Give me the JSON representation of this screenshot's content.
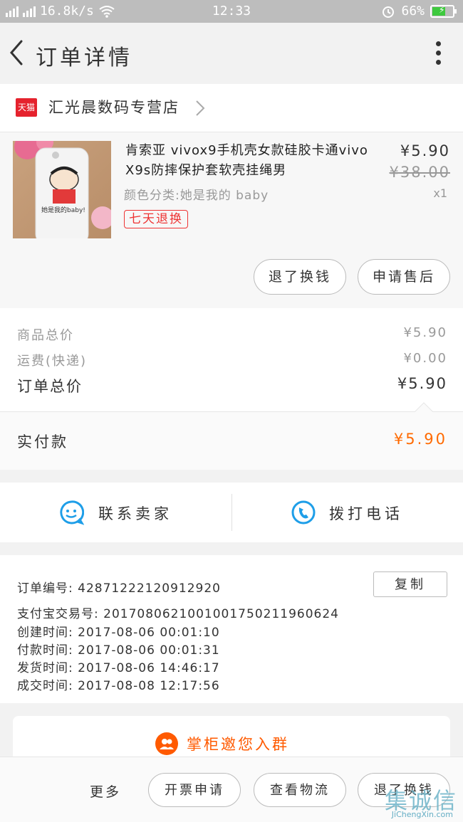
{
  "status_bar": {
    "network_speed": "16.8k/s",
    "time": "12:33",
    "battery": "66%",
    "battery_level": 0.66,
    "sim1": "4G",
    "sim2": "2G"
  },
  "nav": {
    "title": "订单详情"
  },
  "store": {
    "badge": "天猫",
    "name": "汇光晨数码专营店"
  },
  "product": {
    "title": "肯索亚 vivox9手机壳女款硅胶卡通vivo X9s防摔保护套软壳挂绳男",
    "sku": "颜色分类:她是我的 baby",
    "tag": "七天退换",
    "price": "¥5.90",
    "original_price": "¥38.00",
    "quantity": "x1",
    "refund_label": "退了换钱",
    "aftersale_label": "申请售后"
  },
  "summary": {
    "goods_total_label": "商品总价",
    "goods_total": "¥5.90",
    "shipping_label": "运费(快递)",
    "shipping": "¥0.00",
    "order_total_label": "订单总价",
    "order_total": "¥5.90",
    "paid_label": "实付款",
    "paid": "¥5.90"
  },
  "contact": {
    "seller_label": "联系卖家",
    "call_label": "拨打电话"
  },
  "order_info": {
    "order_no": "订单编号: 428712221​20912920",
    "copy_label": "复制",
    "alipay_no": "支付宝交易号: 2017080621001001750211960624",
    "created": "创建时间: 2017-08-06 00:01:10",
    "paid_time": "付款时间: 2017-08-06 00:01:31",
    "shipped": "发货时间: 2017-08-06 14:46:17",
    "completed": "成交时间: 2017-08-08 12:17:56"
  },
  "invite": {
    "text": "掌柜邀您入群"
  },
  "bottom_bar": {
    "more": "更多",
    "invoice": "开票申请",
    "logistics": "查看物流",
    "refund": "退了换钱"
  },
  "watermark": {
    "main": "集诚信",
    "sub": "JiChengXin.com"
  },
  "colors": {
    "accent_orange": "#ff6a00",
    "tmall_red": "#e5222d",
    "contact_blue": "#1e9ee8"
  }
}
